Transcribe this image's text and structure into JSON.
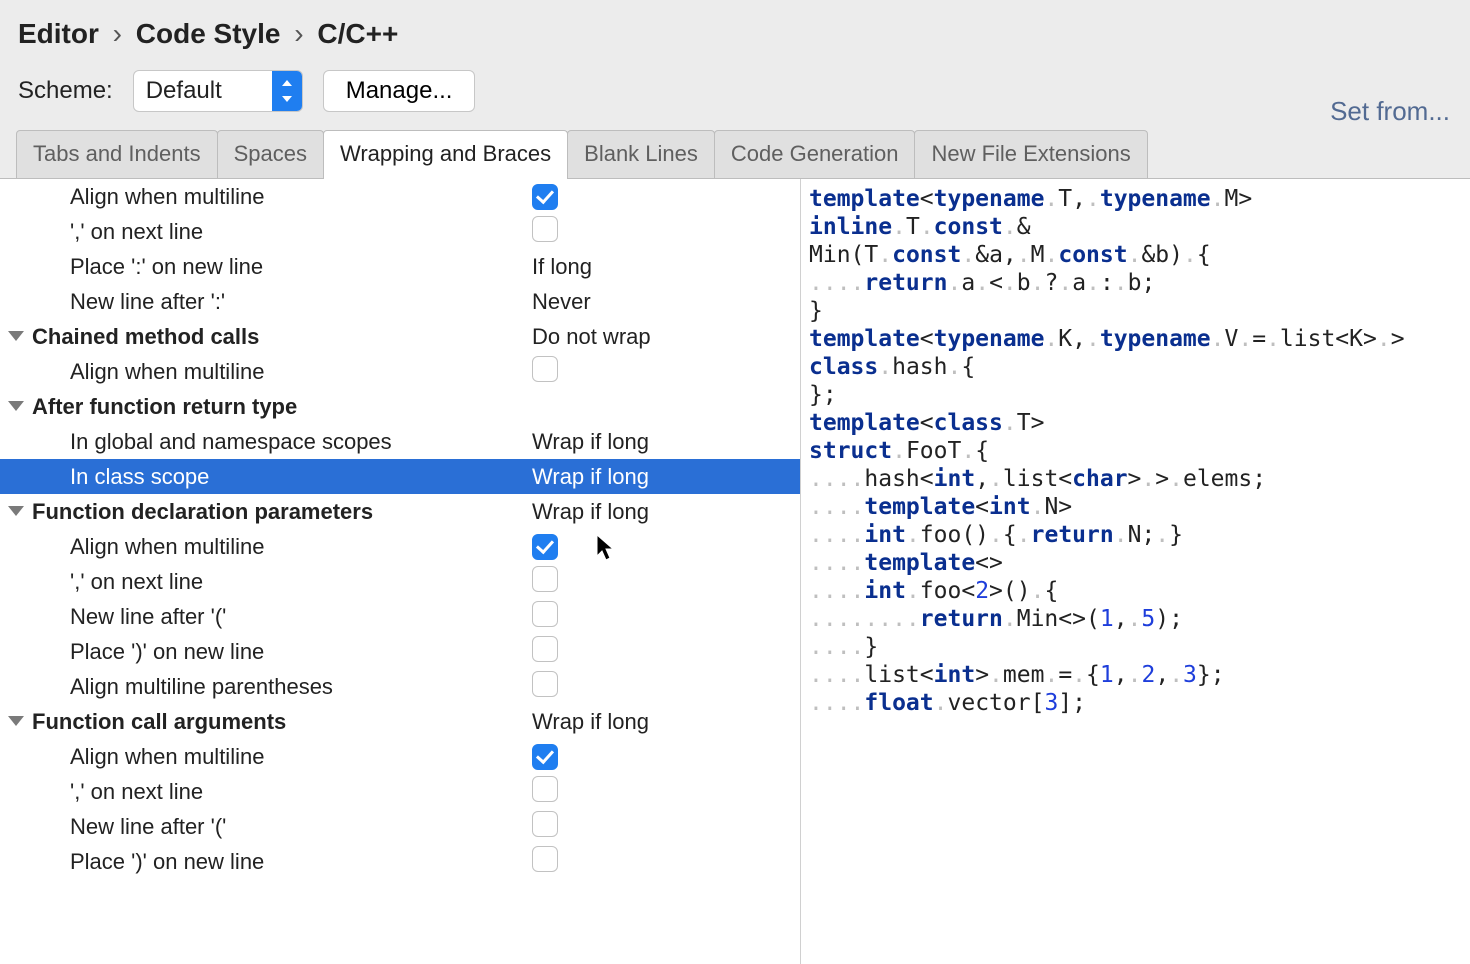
{
  "breadcrumb": [
    "Editor",
    "Code Style",
    "C/C++"
  ],
  "scheme": {
    "label": "Scheme:",
    "value": "Default",
    "manage_label": "Manage..."
  },
  "set_from_label": "Set from...",
  "tabs": [
    {
      "label": "Tabs and Indents",
      "active": false
    },
    {
      "label": "Spaces",
      "active": false
    },
    {
      "label": "Wrapping and Braces",
      "active": true
    },
    {
      "label": "Blank Lines",
      "active": false
    },
    {
      "label": "Code Generation",
      "active": false
    },
    {
      "label": "New File Extensions",
      "active": false
    }
  ],
  "options": [
    {
      "type": "leaf",
      "label": "Align when multiline",
      "value_kind": "check",
      "checked": true
    },
    {
      "type": "leaf",
      "label": "',' on next line",
      "value_kind": "check",
      "checked": false
    },
    {
      "type": "leaf",
      "label": "Place ':' on new line",
      "value_kind": "text",
      "value": "If long"
    },
    {
      "type": "leaf",
      "label": "New line after ':'",
      "value_kind": "text",
      "value": "Never"
    },
    {
      "type": "header",
      "label": "Chained method calls",
      "value_kind": "text",
      "value": "Do not wrap"
    },
    {
      "type": "leaf",
      "label": "Align when multiline",
      "value_kind": "check",
      "checked": false
    },
    {
      "type": "header",
      "label": "After function return type",
      "value_kind": "none"
    },
    {
      "type": "leaf",
      "label": "In global and namespace scopes",
      "value_kind": "text",
      "value": "Wrap if long"
    },
    {
      "type": "leaf",
      "label": "In class scope",
      "value_kind": "text",
      "value": "Wrap if long",
      "selected": true
    },
    {
      "type": "header",
      "label": "Function declaration parameters",
      "value_kind": "text",
      "value": "Wrap if long"
    },
    {
      "type": "leaf",
      "label": "Align when multiline",
      "value_kind": "check",
      "checked": true
    },
    {
      "type": "leaf",
      "label": "',' on next line",
      "value_kind": "check",
      "checked": false
    },
    {
      "type": "leaf",
      "label": "New line after '('",
      "value_kind": "check",
      "checked": false
    },
    {
      "type": "leaf",
      "label": "Place ')' on new line",
      "value_kind": "check",
      "checked": false
    },
    {
      "type": "leaf",
      "label": "Align multiline parentheses",
      "value_kind": "check",
      "checked": false
    },
    {
      "type": "header",
      "label": "Function call arguments",
      "value_kind": "text",
      "value": "Wrap if long"
    },
    {
      "type": "leaf",
      "label": "Align when multiline",
      "value_kind": "check",
      "checked": true
    },
    {
      "type": "leaf",
      "label": "',' on next line",
      "value_kind": "check",
      "checked": false
    },
    {
      "type": "leaf",
      "label": "New line after '('",
      "value_kind": "check",
      "checked": false
    },
    {
      "type": "leaf",
      "label": "Place ')' on new line",
      "value_kind": "check",
      "checked": false
    }
  ],
  "code": [
    [
      [
        "kw",
        "template"
      ],
      [
        "op",
        "<"
      ],
      [
        "kw",
        "typename"
      ],
      [
        "dot",
        "."
      ],
      [
        "op",
        "T,"
      ],
      [
        "dot",
        "."
      ],
      [
        "kw",
        "typename"
      ],
      [
        "dot",
        "."
      ],
      [
        "op",
        "M>"
      ]
    ],
    [
      [
        "kw",
        "inline"
      ],
      [
        "dot",
        "."
      ],
      [
        "op",
        "T"
      ],
      [
        "dot",
        "."
      ],
      [
        "kw",
        "const"
      ],
      [
        "dot",
        "."
      ],
      [
        "op",
        "&"
      ]
    ],
    [
      [
        "op",
        "Min(T"
      ],
      [
        "dot",
        "."
      ],
      [
        "kw",
        "const"
      ],
      [
        "dot",
        "."
      ],
      [
        "op",
        "&a,"
      ],
      [
        "dot",
        "."
      ],
      [
        "op",
        "M"
      ],
      [
        "dot",
        "."
      ],
      [
        "kw",
        "const"
      ],
      [
        "dot",
        "."
      ],
      [
        "op",
        "&b)"
      ],
      [
        "dot",
        "."
      ],
      [
        "op",
        "{"
      ]
    ],
    [
      [
        "dot",
        "...."
      ],
      [
        "kw",
        "return"
      ],
      [
        "dot",
        "."
      ],
      [
        "op",
        "a"
      ],
      [
        "dot",
        "."
      ],
      [
        "op",
        "<"
      ],
      [
        "dot",
        "."
      ],
      [
        "op",
        "b"
      ],
      [
        "dot",
        "."
      ],
      [
        "op",
        "?"
      ],
      [
        "dot",
        "."
      ],
      [
        "op",
        "a"
      ],
      [
        "dot",
        "."
      ],
      [
        "op",
        ":"
      ],
      [
        "dot",
        "."
      ],
      [
        "op",
        "b;"
      ]
    ],
    [
      [
        "op",
        "}"
      ]
    ],
    [
      [
        "op",
        ""
      ]
    ],
    [
      [
        "kw",
        "template"
      ],
      [
        "op",
        "<"
      ],
      [
        "kw",
        "typename"
      ],
      [
        "dot",
        "."
      ],
      [
        "op",
        "K,"
      ],
      [
        "dot",
        "."
      ],
      [
        "kw",
        "typename"
      ],
      [
        "dot",
        "."
      ],
      [
        "op",
        "V"
      ],
      [
        "dot",
        "."
      ],
      [
        "op",
        "="
      ],
      [
        "dot",
        "."
      ],
      [
        "op",
        "list<K>"
      ],
      [
        "dot",
        "."
      ],
      [
        "op",
        ">"
      ]
    ],
    [
      [
        "kw",
        "class"
      ],
      [
        "dot",
        "."
      ],
      [
        "op",
        "hash"
      ],
      [
        "dot",
        "."
      ],
      [
        "op",
        "{"
      ]
    ],
    [
      [
        "op",
        "};"
      ]
    ],
    [
      [
        "op",
        ""
      ]
    ],
    [
      [
        "kw",
        "template"
      ],
      [
        "op",
        "<"
      ],
      [
        "kw",
        "class"
      ],
      [
        "dot",
        "."
      ],
      [
        "op",
        "T>"
      ]
    ],
    [
      [
        "kw",
        "struct"
      ],
      [
        "dot",
        "."
      ],
      [
        "op",
        "FooT"
      ],
      [
        "dot",
        "."
      ],
      [
        "op",
        "{"
      ]
    ],
    [
      [
        "dot",
        "...."
      ],
      [
        "op",
        "hash<"
      ],
      [
        "kw",
        "int"
      ],
      [
        "op",
        ","
      ],
      [
        "dot",
        "."
      ],
      [
        "op",
        "list<"
      ],
      [
        "kw",
        "char"
      ],
      [
        "op",
        ">"
      ],
      [
        "dot",
        "."
      ],
      [
        "op",
        ">"
      ],
      [
        "dot",
        "."
      ],
      [
        "op",
        "elems;"
      ]
    ],
    [
      [
        "op",
        ""
      ]
    ],
    [
      [
        "dot",
        "...."
      ],
      [
        "kw",
        "template"
      ],
      [
        "op",
        "<"
      ],
      [
        "kw",
        "int"
      ],
      [
        "dot",
        "."
      ],
      [
        "op",
        "N>"
      ]
    ],
    [
      [
        "dot",
        "...."
      ],
      [
        "kw",
        "int"
      ],
      [
        "dot",
        "."
      ],
      [
        "op",
        "foo()"
      ],
      [
        "dot",
        "."
      ],
      [
        "op",
        "{"
      ],
      [
        "dot",
        "."
      ],
      [
        "kw",
        "return"
      ],
      [
        "dot",
        "."
      ],
      [
        "op",
        "N;"
      ],
      [
        "dot",
        "."
      ],
      [
        "op",
        "}"
      ]
    ],
    [
      [
        "op",
        ""
      ]
    ],
    [
      [
        "dot",
        "...."
      ],
      [
        "kw",
        "template"
      ],
      [
        "op",
        "<>"
      ]
    ],
    [
      [
        "dot",
        "...."
      ],
      [
        "kw",
        "int"
      ],
      [
        "dot",
        "."
      ],
      [
        "op",
        "foo<"
      ],
      [
        "num",
        "2"
      ],
      [
        "op",
        ">()"
      ],
      [
        "dot",
        "."
      ],
      [
        "op",
        "{"
      ]
    ],
    [
      [
        "dot",
        "........"
      ],
      [
        "kw",
        "return"
      ],
      [
        "dot",
        "."
      ],
      [
        "op",
        "Min<>("
      ],
      [
        "num",
        "1"
      ],
      [
        "op",
        ","
      ],
      [
        "dot",
        "."
      ],
      [
        "num",
        "5"
      ],
      [
        "op",
        ");"
      ]
    ],
    [
      [
        "dot",
        "...."
      ],
      [
        "op",
        "}"
      ]
    ],
    [
      [
        "op",
        ""
      ]
    ],
    [
      [
        "dot",
        "...."
      ],
      [
        "op",
        "list<"
      ],
      [
        "kw",
        "int"
      ],
      [
        "op",
        ">"
      ],
      [
        "dot",
        "."
      ],
      [
        "op",
        "mem"
      ],
      [
        "dot",
        "."
      ],
      [
        "op",
        "="
      ],
      [
        "dot",
        "."
      ],
      [
        "op",
        "{"
      ],
      [
        "num",
        "1"
      ],
      [
        "op",
        ","
      ],
      [
        "dot",
        "."
      ],
      [
        "num",
        "2"
      ],
      [
        "op",
        ","
      ],
      [
        "dot",
        "."
      ],
      [
        "num",
        "3"
      ],
      [
        "op",
        "};"
      ]
    ],
    [
      [
        "dot",
        "...."
      ],
      [
        "kw",
        "float"
      ],
      [
        "dot",
        "."
      ],
      [
        "op",
        "vector["
      ],
      [
        "num",
        "3"
      ],
      [
        "op",
        "];"
      ]
    ]
  ]
}
